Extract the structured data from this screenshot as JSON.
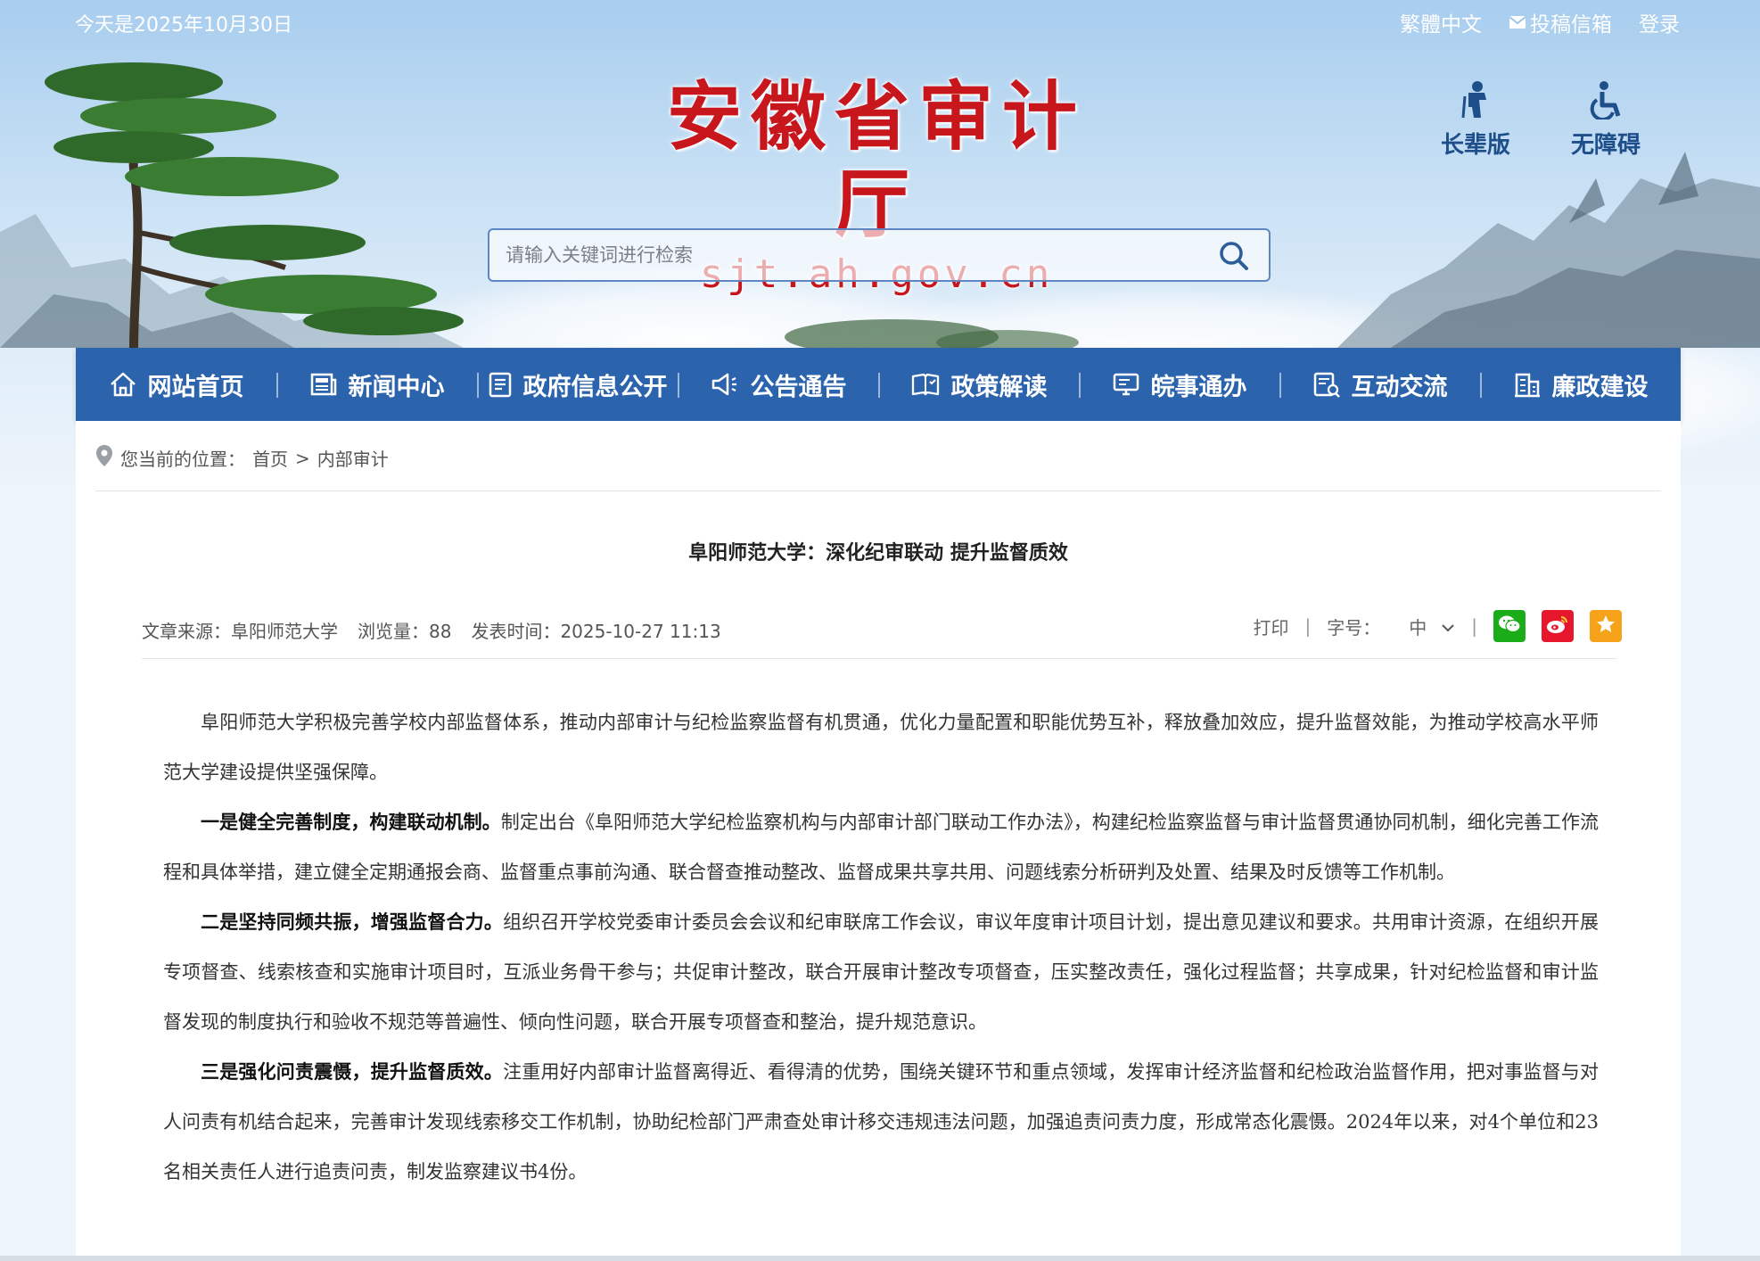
{
  "topbar": {
    "date": "今天是2025年10月30日",
    "links": [
      "繁體中文",
      "投稿信箱",
      "登录"
    ]
  },
  "logo": {
    "title": "安徽省审计厅",
    "domain": "sjt.ah.gov.cn"
  },
  "accessibility": {
    "elder": "长辈版",
    "barrier_free": "无障碍"
  },
  "search": {
    "placeholder": "请输入关键词进行检索",
    "value": ""
  },
  "nav": [
    {
      "label": "网站首页",
      "icon": "home-icon"
    },
    {
      "label": "新闻中心",
      "icon": "newspaper-icon"
    },
    {
      "label": "政府信息公开",
      "icon": "document-list-icon"
    },
    {
      "label": "公告通告",
      "icon": "megaphone-icon"
    },
    {
      "label": "政策解读",
      "icon": "open-book-icon"
    },
    {
      "label": "皖事通办",
      "icon": "monitor-icon"
    },
    {
      "label": "互动交流",
      "icon": "chat-form-icon"
    },
    {
      "label": "廉政建设",
      "icon": "building-icon"
    }
  ],
  "breadcrumb": {
    "prefix": "您当前的位置：",
    "home": "首页",
    "sep": ">",
    "current": "内部审计"
  },
  "article": {
    "title": "阜阳师范大学：深化纪审联动 提升监督质效",
    "meta": {
      "source": "文章来源：阜阳师范大学",
      "views": "浏览量：88",
      "time": "发表时间：2025-10-27 11:13",
      "print": "打印",
      "font_size_label": "字号：",
      "font_size_value": "中",
      "divider": "|"
    },
    "paragraphs": [
      {
        "lead": "",
        "text": "阜阳师范大学积极完善学校内部监督体系，推动内部审计与纪检监察监督有机贯通，优化力量配置和职能优势互补，释放叠加效应，提升监督效能，为推动学校高水平师范大学建设提供坚强保障。"
      },
      {
        "lead": "一是健全完善制度，构建联动机制。",
        "text": "制定出台《阜阳师范大学纪检监察机构与内部审计部门联动工作办法》，构建纪检监察监督与审计监督贯通协同机制，细化完善工作流程和具体举措，建立健全定期通报会商、监督重点事前沟通、联合督查推动整改、监督成果共享共用、问题线索分析研判及处置、结果及时反馈等工作机制。"
      },
      {
        "lead": "二是坚持同频共振，增强监督合力。",
        "text": "组织召开学校党委审计委员会会议和纪审联席工作会议，审议年度审计项目计划，提出意见建议和要求。共用审计资源，在组织开展专项督查、线索核查和实施审计项目时，互派业务骨干参与；共促审计整改，联合开展审计整改专项督查，压实整改责任，强化过程监督；共享成果，针对纪检监督和审计监督发现的制度执行和验收不规范等普遍性、倾向性问题，联合开展专项督查和整治，提升规范意识。"
      },
      {
        "lead": "三是强化问责震慑，提升监督质效。",
        "text": "注重用好内部审计监督离得近、看得清的优势，围绕关键环节和重点领域，发挥审计经济监督和纪检政治监督作用，把对事监督与对人问责有机结合起来，完善审计发现线索移交工作机制，协助纪检部门严肃查处审计移交违规违法问题，加强追责问责力度，形成常态化震慑。2024年以来，对4个单位和23名相关责任人进行追责问责，制发监察建议书4份。"
      }
    ]
  },
  "colors": {
    "nav": "#2c63ad",
    "brand_red": "#c8161d",
    "wechat": "#1aad19",
    "weibo": "#e6162d",
    "favorite": "#f7a21b"
  }
}
